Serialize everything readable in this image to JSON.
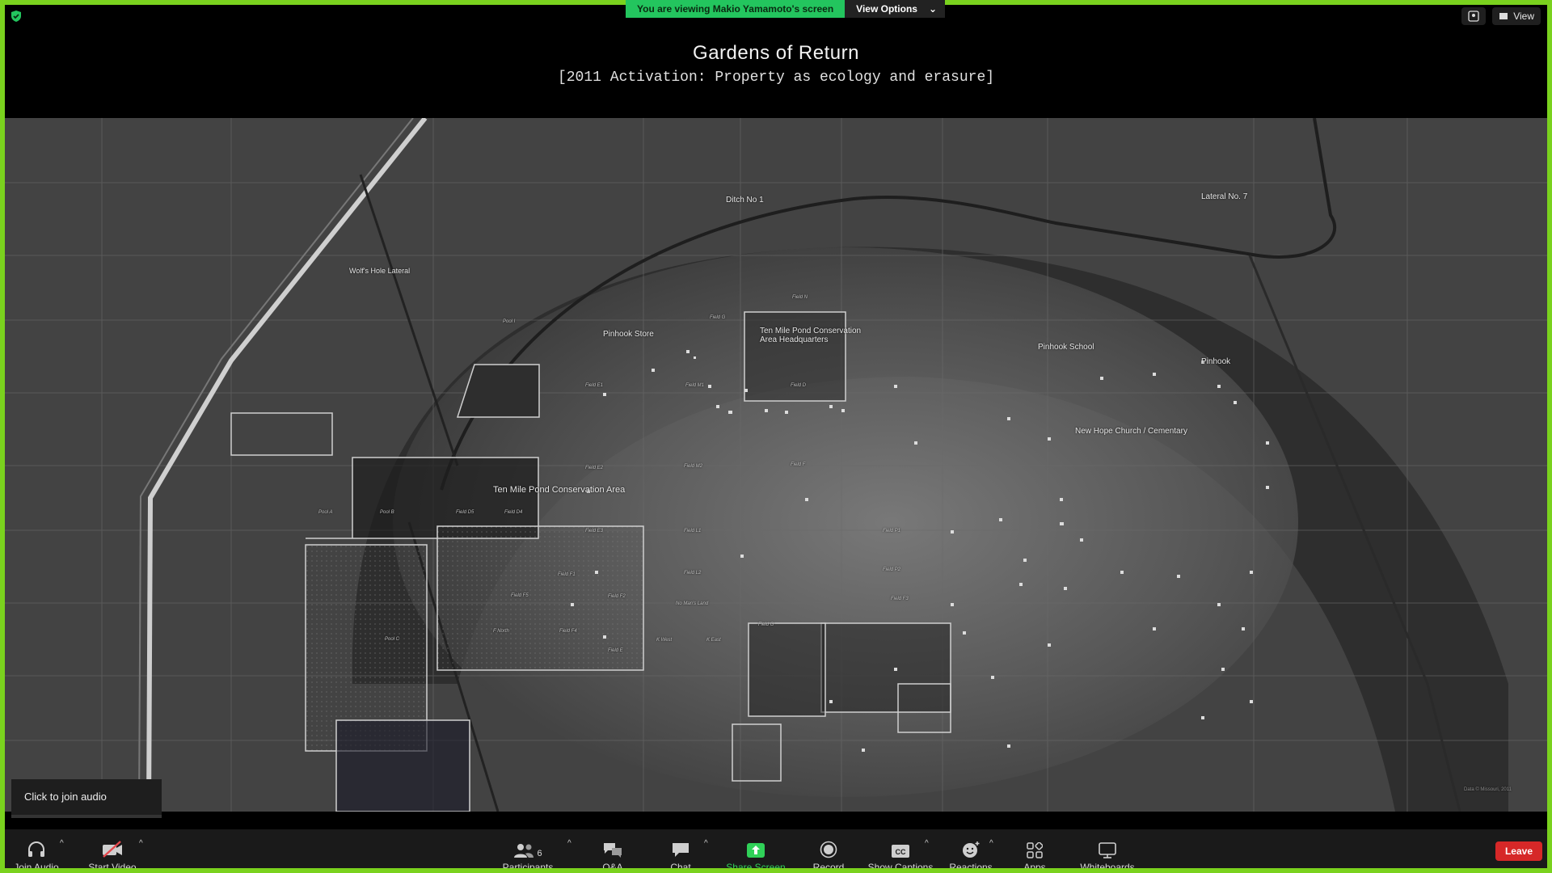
{
  "banner": {
    "viewing_text": "You are viewing Makio Yamamoto's screen",
    "view_options_label": "View Options"
  },
  "top_right": {
    "view_label": "View"
  },
  "slide": {
    "title": "Gardens of Return",
    "subtitle": "[2011 Activation: Property as ecology and erasure]"
  },
  "map": {
    "labels": {
      "ditch1": "Ditch No 1",
      "lateral7": "Lateral No. 7",
      "wolfs_hole": "Wolf's Hole Lateral",
      "pinhook_store": "Pinhook Store",
      "tmp_hq": "Ten Mile Pond Conservation\nArea Headquarters",
      "pinhook_school": "Pinhook School",
      "pinhook": "Pinhook",
      "new_hope": "New Hope Church / Cementary",
      "tmp_area": "Ten Mile Pond Conservation Area",
      "credit": "Data © Missouri, 2011"
    },
    "fields": [
      "Pool I",
      "Field N",
      "Field G",
      "Field E1",
      "Field M1",
      "Field D",
      "Field E2",
      "Field M2",
      "Field F",
      "Pool A",
      "Pool B",
      "Field D5",
      "Field D4",
      "Field E3",
      "Field L1",
      "Field F1",
      "Field L2",
      "Field F2",
      "Field F5",
      "Field F4",
      "Field P1",
      "Field P2",
      "Field F3",
      "No Man's Land",
      "Field G",
      "Pool C",
      "F North",
      "K West",
      "K East",
      "Field E"
    ]
  },
  "join_tip": "Click to join audio",
  "toolbar": {
    "join_audio": "Join Audio",
    "start_video": "Start Video",
    "participants": "Participants",
    "participants_count": "6",
    "qa": "Q&A",
    "chat": "Chat",
    "share_screen": "Share Screen",
    "record": "Record",
    "show_captions": "Show Captions",
    "reactions": "Reactions",
    "apps": "Apps",
    "whiteboards": "Whiteboards",
    "leave": "Leave"
  },
  "colors": {
    "share_border": "#7ad21e",
    "banner_green": "#23c55e",
    "leave_red": "#d62828",
    "share_green": "#30d158"
  }
}
